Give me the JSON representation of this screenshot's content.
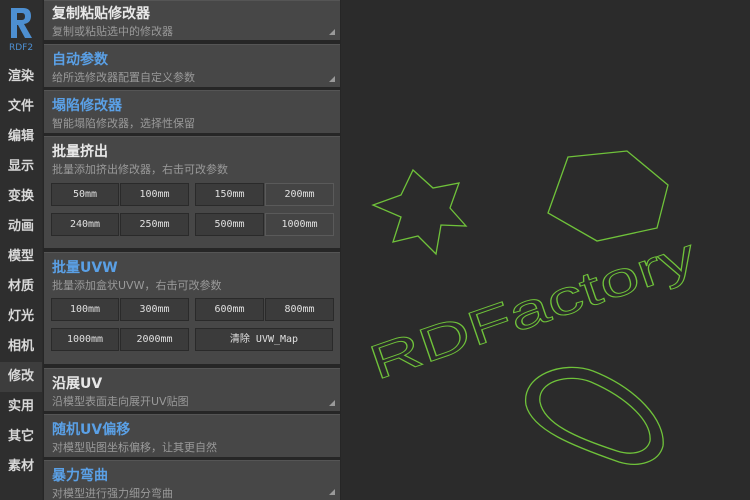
{
  "logo": {
    "letter": "R",
    "sub": "RDF2"
  },
  "nav": [
    "渲染",
    "文件",
    "编辑",
    "显示",
    "变换",
    "动画",
    "模型",
    "材质",
    "灯光",
    "相机",
    "修改",
    "实用",
    "其它",
    "素材"
  ],
  "nav_active": "修改",
  "cards": {
    "copy_paste": {
      "title": "复制粘贴修改器",
      "desc": "复制或粘贴选中的修改器"
    },
    "auto_params": {
      "title": "自动参数",
      "desc": "给所选修改器配置自定义参数"
    },
    "collapse": {
      "title": "塌陷修改器",
      "desc": "智能塌陷修改器，选择性保留"
    },
    "extrude": {
      "title": "批量挤出",
      "desc": "批量添加挤出修改器，右击可改参数",
      "buttons": [
        "50mm",
        "100mm",
        "150mm",
        "200mm",
        "240mm",
        "250mm",
        "500mm",
        "1000mm"
      ]
    },
    "uvw": {
      "title": "批量UVW",
      "desc": "批量添加盒状UVW，右击可改参数",
      "buttons": [
        "100mm",
        "300mm",
        "600mm",
        "800mm",
        "1000mm",
        "2000mm"
      ],
      "clear": "清除 UVW_Map"
    },
    "unwrap": {
      "title": "沿展UV",
      "desc": "沿模型表面走向展开UV贴图"
    },
    "random_uv": {
      "title": "随机UV偏移",
      "desc": "对模型贴图坐标偏移，让其更自然"
    },
    "bend": {
      "title": "暴力弯曲",
      "desc": "对模型进行强力细分弯曲"
    }
  },
  "colors": {
    "title_blue": "#5aa0e6",
    "title_white": "#e8e8e8",
    "shape_green": "#6fc23a"
  },
  "viewport": {
    "text": "RDFactory"
  }
}
